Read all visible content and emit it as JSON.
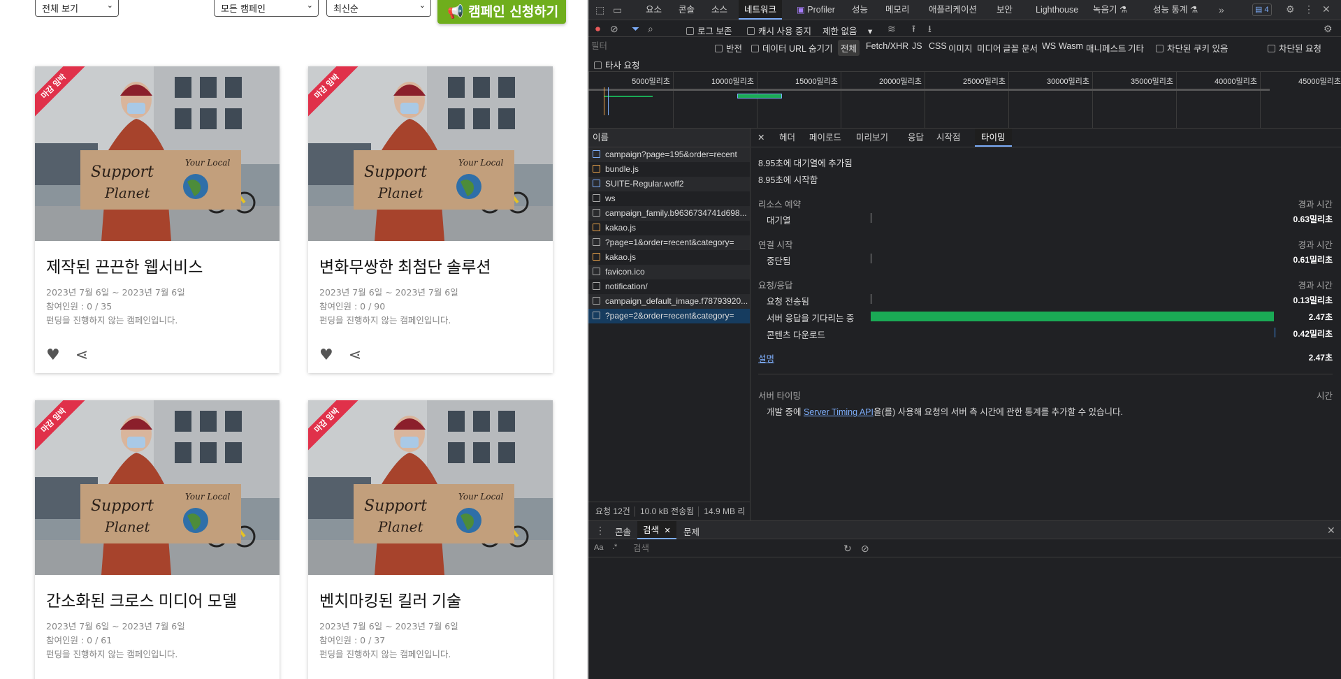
{
  "page": {
    "filter_view": "전체 보기",
    "filter_campaign": "모든 캠페인",
    "filter_sort": "최신순",
    "create_button": "캠페인 신청하기",
    "cards": [
      {
        "title": "제작된 끈끈한 웹서비스",
        "dates": "2023년 7월 6일 ~ 2023년 7월 6일",
        "participants": "참여인원 : 0 / 35",
        "status": "펀딩을 진행하지 않는 캠페인입니다.",
        "ribbon": "마감 임박"
      },
      {
        "title": "변화무쌍한 최첨단 솔루션",
        "dates": "2023년 7월 6일 ~ 2023년 7월 6일",
        "participants": "참여인원 : 0 / 90",
        "status": "펀딩을 진행하지 않는 캠페인입니다.",
        "ribbon": "마감 임박"
      },
      {
        "title": "간소화된 크로스 미디어 모델",
        "dates": "2023년 7월 6일 ~ 2023년 7월 6일",
        "participants": "참여인원 : 0 / 61",
        "status": "펀딩을 진행하지 않는 캠페인입니다.",
        "ribbon": "마감 임박"
      },
      {
        "title": "벤치마킹된 킬러 기술",
        "dates": "2023년 7월 6일 ~ 2023년 7월 6일",
        "participants": "참여인원 : 0 / 37",
        "status": "펀딩을 진행하지 않는 캠페인입니다.",
        "ribbon": "마감 임박"
      }
    ],
    "sign_text_1": "Support",
    "sign_text_2": "Planet",
    "sign_text_3": "Your Local"
  },
  "devtools": {
    "tabs": [
      "요소",
      "콘솔",
      "소스",
      "네트워크",
      "Profiler",
      "성능",
      "메모리",
      "애플리케이션",
      "보안",
      "Lighthouse",
      "녹음기 ⚗",
      "성능 통계 ⚗"
    ],
    "active_tab": "네트워크",
    "issues_count": "4",
    "network_bar": {
      "preserve_log": "로그 보존",
      "disable_cache": "캐시 사용 중지",
      "throttle": "제한 없음"
    },
    "filter": {
      "placeholder": "필터",
      "invert": "반전",
      "hide_data_urls": "데이터 URL 숨기기",
      "types": [
        "전체",
        "Fetch/XHR",
        "JS",
        "CSS",
        "이미지",
        "미디어",
        "글꼴",
        "문서",
        "WS",
        "Wasm",
        "매니페스트",
        "기타"
      ],
      "blocked_cookies": "차단된 쿠키 있음",
      "blocked_requests": "차단된 요청",
      "third_party": "타사 요청"
    },
    "timeline_ticks": [
      "5000밀리초",
      "10000밀리초",
      "15000밀리초",
      "20000밀리초",
      "25000밀리초",
      "30000밀리초",
      "35000밀리초",
      "40000밀리초",
      "45000밀리초"
    ],
    "name_header": "이름",
    "requests": [
      {
        "name": "campaign?page=195&order=recent",
        "type": "doc"
      },
      {
        "name": "bundle.js",
        "type": "js"
      },
      {
        "name": "SUITE-Regular.woff2",
        "type": "font"
      },
      {
        "name": "ws",
        "type": "other"
      },
      {
        "name": "campaign_family.b9636734741d698...",
        "type": "img"
      },
      {
        "name": "kakao.js",
        "type": "js"
      },
      {
        "name": "?page=1&order=recent&category=",
        "type": "other"
      },
      {
        "name": "kakao.js",
        "type": "js"
      },
      {
        "name": "favicon.ico",
        "type": "other"
      },
      {
        "name": "notification/",
        "type": "other"
      },
      {
        "name": "campaign_default_image.f78793920...",
        "type": "img"
      },
      {
        "name": "?page=2&order=recent&category=",
        "type": "other"
      }
    ],
    "status": {
      "requests": "요청 12건",
      "transferred": "10.0 kB 전송됨",
      "resources": "14.9 MB 리"
    },
    "detail_tabs": [
      "헤더",
      "페이로드",
      "미리보기",
      "응답",
      "시작점",
      "타이밍"
    ],
    "active_detail_tab": "타이밍",
    "timing": {
      "queued": "8.95초에 대기열에 추가됨",
      "started": "8.95초에 시작함",
      "resource_scheduling": "리소스 예약",
      "duration_header": "경과 시간",
      "queueing": "대기열",
      "queueing_val": "0.63밀리초",
      "connection_start": "연결 시작",
      "stalled": "중단됨",
      "stalled_val": "0.61밀리초",
      "request_response": "요청/응답",
      "request_sent": "요청 전송됨",
      "request_sent_val": "0.13밀리초",
      "waiting": "서버 응답을 기다리는 중",
      "waiting_val": "2.47초",
      "download": "콘텐츠 다운로드",
      "download_val": "0.42밀리초",
      "explanation": "설명",
      "total": "2.47초",
      "server_timing": "서버 타이밍",
      "time_header": "시간",
      "server_note_pre": "개발 중에 ",
      "server_note_link": "Server Timing API",
      "server_note_post": "을(를) 사용해 요청의 서버 측 시간에 관한 통계를 추가할 수 있습니다."
    },
    "drawer": {
      "tabs": [
        "콘솔",
        "검색",
        "문제"
      ],
      "active": "검색",
      "search_placeholder": "검색",
      "case_toggle": "Aa",
      "regex_toggle": ".*"
    },
    "colors": {
      "waiting_bar": "#1aaa55",
      "accent": "#7cacf8",
      "button_green": "#6fae1c",
      "ribbon": "#e0314a"
    }
  }
}
